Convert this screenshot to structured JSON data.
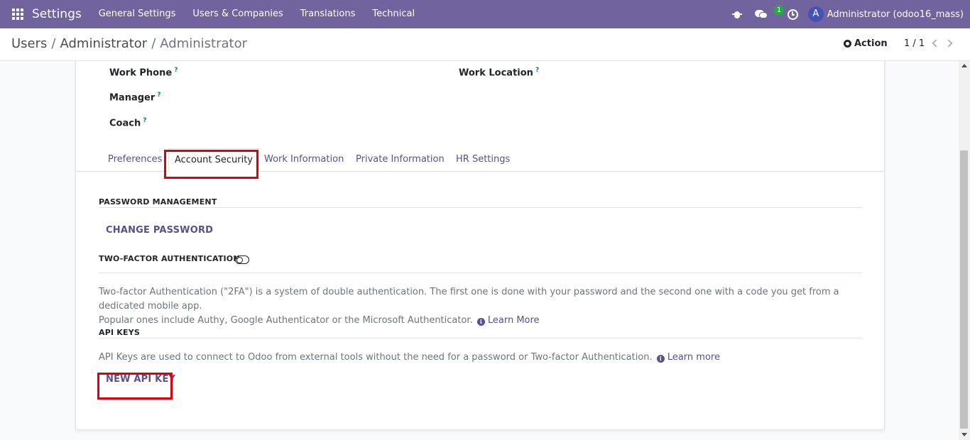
{
  "navbar": {
    "app_name": "Settings",
    "menu": [
      "General Settings",
      "Users & Companies",
      "Translations",
      "Technical"
    ],
    "chat_badge": "1",
    "avatar_letter": "A",
    "user": "Administrator (odoo16_mass)"
  },
  "breadcrumb": {
    "items": [
      "Users",
      "Administrator"
    ],
    "separator": "/",
    "current": "Administrator"
  },
  "control": {
    "action_label": "Action",
    "pager": "1 / 1"
  },
  "form": {
    "fields": {
      "work_phone": "Work Phone",
      "work_location": "Work Location",
      "manager": "Manager",
      "coach": "Coach",
      "help_mark": "?"
    },
    "tabs": [
      "Preferences",
      "Account Security",
      "Work Information",
      "Private Information",
      "HR Settings"
    ],
    "active_tab": "Account Security",
    "security": {
      "password_title": "PASSWORD MANAGEMENT",
      "change_password": "CHANGE PASSWORD",
      "tfa_title": "TWO-FACTOR AUTHENTICATION",
      "tfa_enabled": false,
      "tfa_text_1": "Two-factor Authentication (\"2FA\") is a system of double authentication. The first one is done with your password and the second one with a code you get from a dedicated mobile app.",
      "tfa_text_2": "Popular ones include Authy, Google Authenticator or the Microsoft Authenticator.",
      "tfa_learn_more": "Learn More",
      "api_title": "API KEYS",
      "api_text": "API Keys are used to connect to Odoo from external tools without the need for a password or Two-factor Authentication.",
      "api_learn_more": "Learn more",
      "new_api_key": "NEW API KEY"
    }
  },
  "colors": {
    "navbar": "#71639e",
    "link": "#5a4f8b",
    "highlight": "#e0000b",
    "badge": "#28a745"
  }
}
